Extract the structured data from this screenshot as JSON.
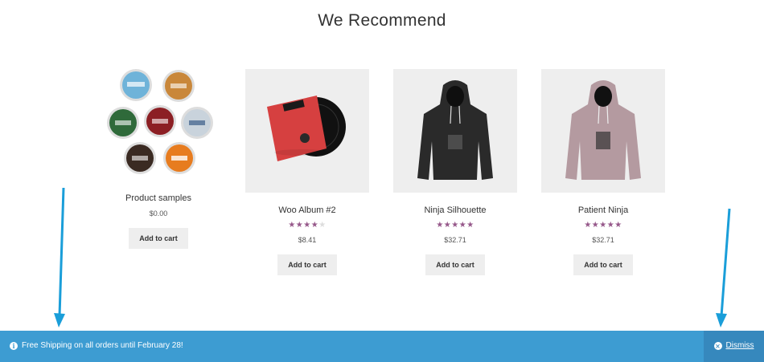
{
  "section": {
    "title": "We Recommend"
  },
  "products": [
    {
      "name": "Product samples",
      "price": "$0.00",
      "cta": "Add to cart",
      "rating": null
    },
    {
      "name": "Woo Album #2",
      "price": "$8.41",
      "cta": "Add to cart",
      "rating": 4,
      "rating_max": 5
    },
    {
      "name": "Ninja Silhouette",
      "price": "$32.71",
      "cta": "Add to cart",
      "rating": 5,
      "rating_max": 5
    },
    {
      "name": "Patient Ninja",
      "price": "$32.71",
      "cta": "Add to cart",
      "rating": 5,
      "rating_max": 5
    }
  ],
  "notice": {
    "icon": "info-icon",
    "message": "Free Shipping on all orders until February 28!",
    "dismiss_label": "Dismiss",
    "dismiss_icon": "close-circle-icon",
    "background": "#3d9cd2"
  },
  "colors": {
    "rating_star": "#96588a",
    "annotation_arrow": "#1a9ed9"
  }
}
